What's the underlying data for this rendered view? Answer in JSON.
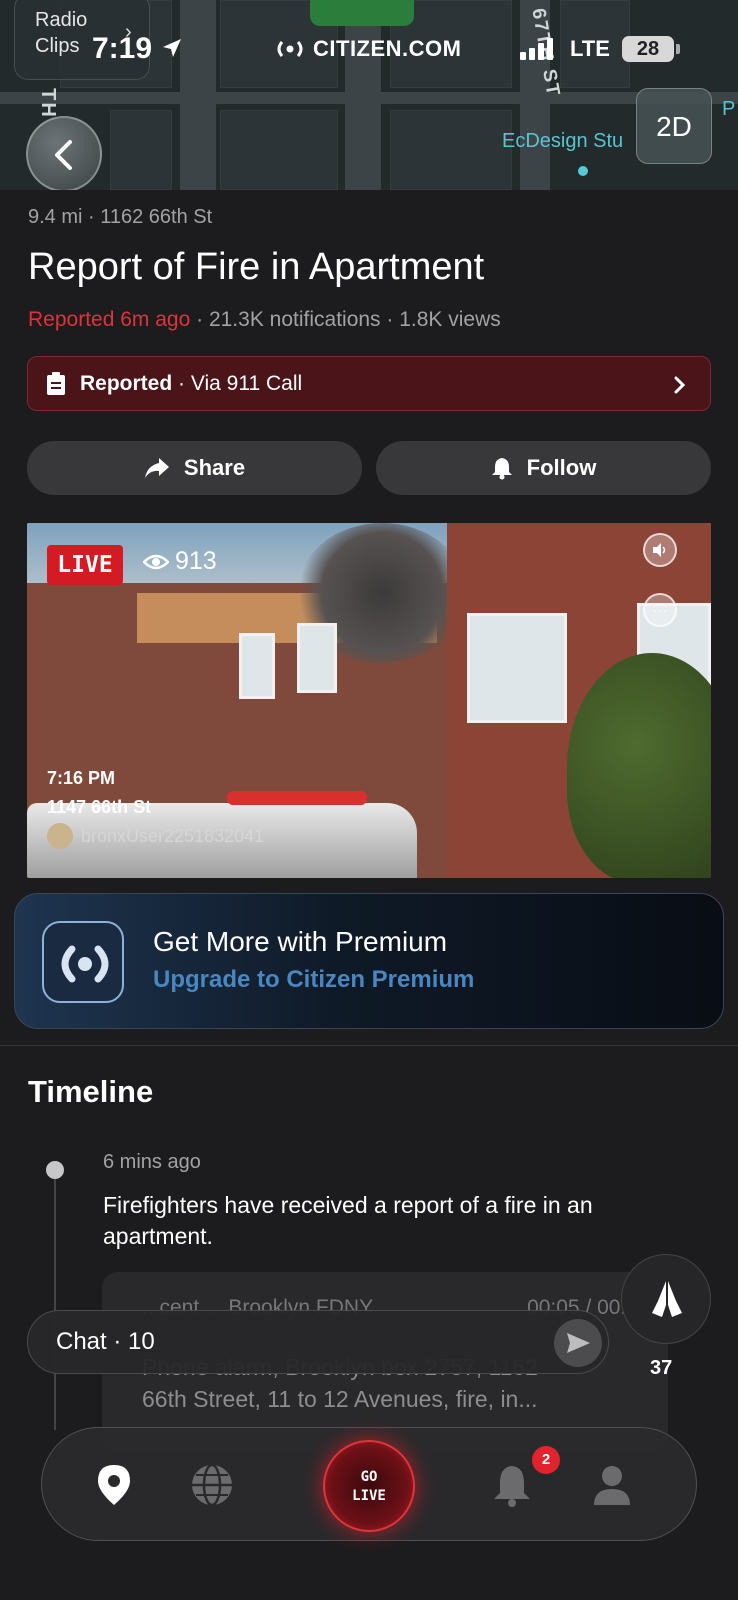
{
  "status_bar": {
    "time": "7:19",
    "brand": "CITIZEN.COM",
    "network": "LTE",
    "battery": "28"
  },
  "map": {
    "radio_clips_line1": "Radio",
    "radio_clips_line2": "Clips",
    "street_label_left": "TH",
    "street_label_right": "67TH ST",
    "poi_label": "EcDesign Stu",
    "poi_partial": "P",
    "view_toggle": "2D"
  },
  "incident": {
    "distance_address": "9.4 mi · 1162 66th St",
    "title": "Report of Fire in Apartment",
    "reported_time": "Reported 6m ago",
    "stats": " · 21.3K notifications · 1.8K views",
    "status_label": "Reported",
    "status_source": " · Via 911 Call"
  },
  "actions": {
    "share_label": "Share",
    "follow_label": "Follow"
  },
  "video": {
    "live_label": "LIVE",
    "viewers": "913",
    "time": "7:16 PM",
    "address": "1147 66th St",
    "username": "bronxUser2251832041"
  },
  "premium": {
    "heading": "Get More with Premium",
    "subheading": "Upgrade to Citizen Premium"
  },
  "timeline": {
    "title": "Timeline",
    "entries": [
      {
        "time": "6 mins ago",
        "text": "Firefighters have received a report of a fire in an apartment.",
        "card_header_left": "...cent ... Brooklyn FDNY",
        "card_header_right": "00:05 / 00:3",
        "card_line1": "Phone alarm, Brooklyn box 2757, 1162",
        "card_line2": "66th Street, 11 to 12 Avenues, fire, in..."
      }
    ]
  },
  "chat": {
    "label": "Chat · 10"
  },
  "reactions": {
    "pray_count": "37"
  },
  "nav": {
    "go_live_line1": "GO",
    "go_live_line2": "LIVE",
    "notifications_badge": "2"
  },
  "colors": {
    "accent_red": "#e0323a",
    "premium_blue": "#4a86c0",
    "background": "#1c1c1e"
  }
}
